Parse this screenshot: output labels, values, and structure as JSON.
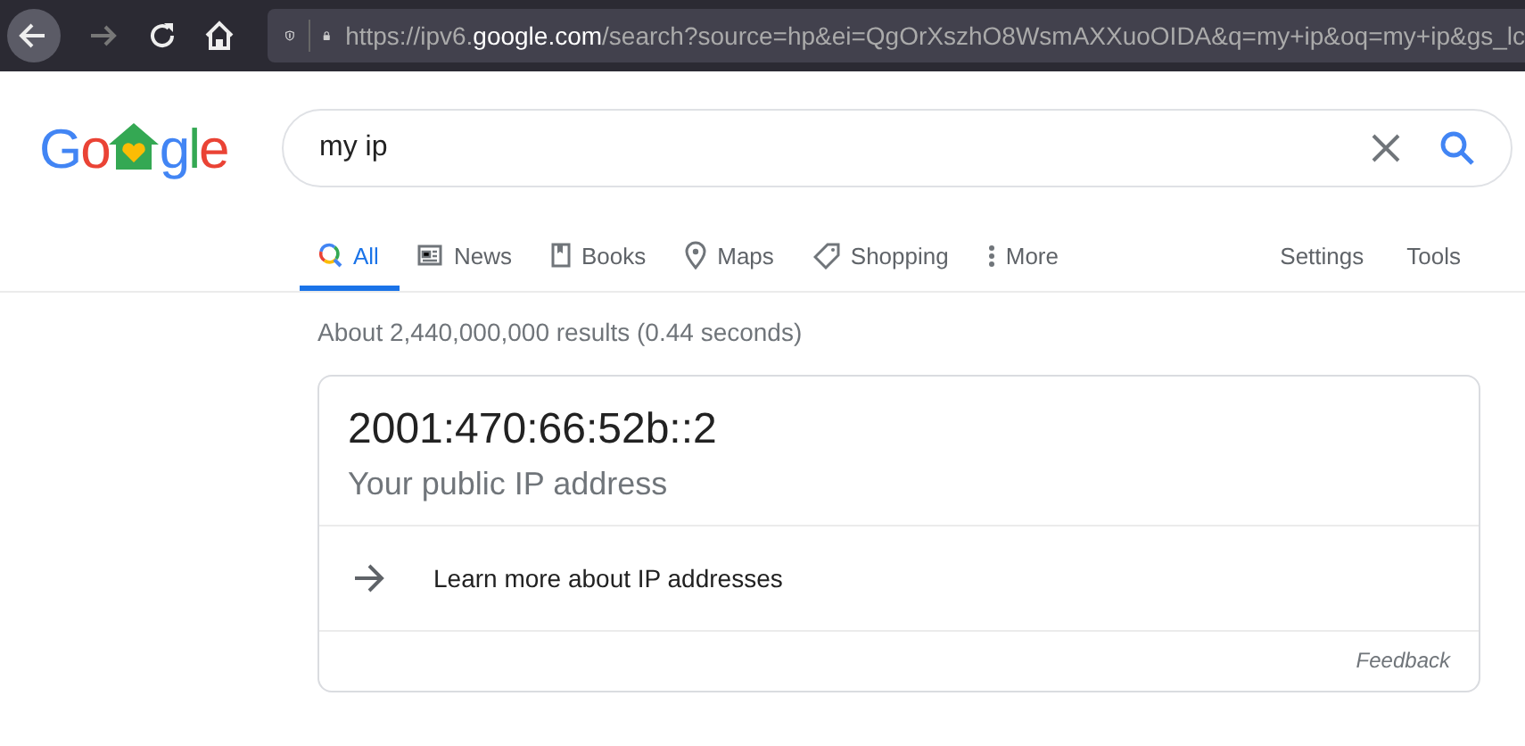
{
  "browser": {
    "url": {
      "prefix": "https://ipv6.",
      "domain": "google.com",
      "rest": "/search?source=hp&ei=QgOrXszhO8WsmAXXuoOIDA&q=my+ip&oq=my+ip&gs_lc"
    }
  },
  "logo": {
    "before": [
      {
        "text": "G",
        "color": "#4285f4"
      },
      {
        "text": "o",
        "color": "#ea4335"
      }
    ],
    "after": [
      {
        "text": "g",
        "color": "#4285f4"
      },
      {
        "text": "l",
        "color": "#34a853"
      },
      {
        "text": "e",
        "color": "#ea4335"
      }
    ]
  },
  "search": {
    "value": "my ip"
  },
  "tabs": [
    {
      "label": "All",
      "kind": "all",
      "selected": true
    },
    {
      "label": "News",
      "kind": "news",
      "selected": false
    },
    {
      "label": "Books",
      "kind": "books",
      "selected": false
    },
    {
      "label": "Maps",
      "kind": "maps",
      "selected": false
    },
    {
      "label": "Shopping",
      "kind": "shopping",
      "selected": false
    },
    {
      "label": "More",
      "kind": "more",
      "selected": false
    }
  ],
  "tools": [
    "Settings",
    "Tools"
  ],
  "result_stats": "About 2,440,000,000 results (0.44 seconds)",
  "answer": {
    "ip": "2001:470:66:52b::2",
    "caption": "Your public IP address",
    "link": "Learn more about IP addresses",
    "feedback": "Feedback"
  }
}
